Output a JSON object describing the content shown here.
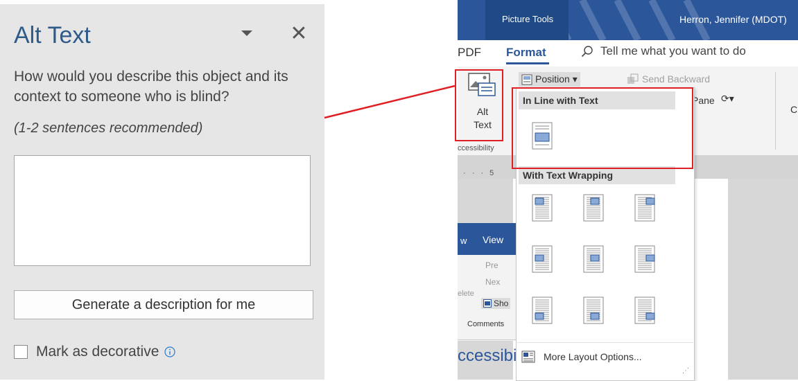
{
  "alt_text_pane": {
    "title": "Alt Text",
    "close_glyph": "✕",
    "question": "How would you describe this object and its context to someone who is blind?",
    "hint": "(1-2 sentences recommended)",
    "description_value": "",
    "generate_button": "Generate a description for me",
    "decorative_label": "Mark as decorative",
    "decorative_checked": false,
    "info_icon": "info-icon",
    "title_color": "#2e5a8a"
  },
  "ribbon": {
    "context_tab": "Picture Tools",
    "user": "Herron, Jennifer (MDOT)",
    "tabs": {
      "partial_tab": "PDF",
      "active_tab": "Format"
    },
    "tell_me": "Tell me what you want to do",
    "alt_text_button": "Alt Text",
    "group_label": "ccessibility",
    "position_button": "Position ▾",
    "send_backward": "Send Backward",
    "selection_pane": "Pane",
    "crop_partial": "C",
    "ruler_text": "· · · 5",
    "accent_color": "#2b579a"
  },
  "review_ribbon": {
    "partial_tab": "w",
    "view_tab": "View",
    "prev": "Pre",
    "next": "Nex",
    "delete": "elete",
    "show": "Sho",
    "group": "Comments",
    "doc_heading": "ccessibilit"
  },
  "position_dropdown": {
    "section_inline": "In Line with Text",
    "section_wrapping": "With Text Wrapping",
    "more_options": "More Layout Options...",
    "wrap_options": [
      "top-left",
      "top-center",
      "top-right",
      "middle-left",
      "middle-center",
      "middle-right",
      "bottom-left",
      "bottom-center",
      "bottom-right"
    ]
  },
  "annotation": {
    "highlight_color": "#e01e24"
  }
}
